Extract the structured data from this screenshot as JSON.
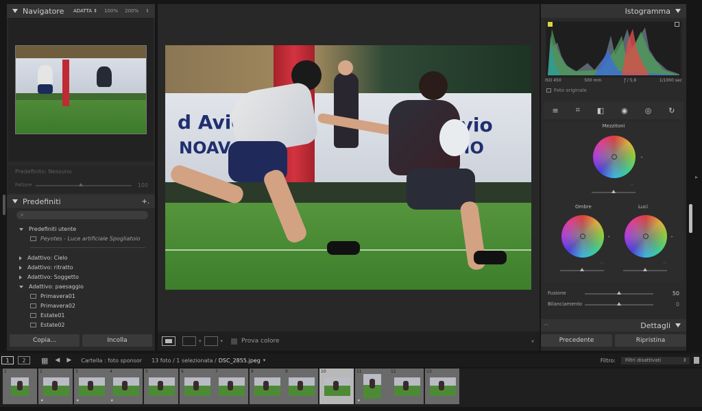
{
  "navigator": {
    "title": "Navigatore",
    "opts": [
      "ADATTA ⇕",
      "100%",
      "200%",
      "⇕"
    ]
  },
  "preset_strength": {
    "label": "Predefinito: Nessuno",
    "slider_label": "Fattore",
    "value": "100"
  },
  "presets": {
    "title": "Predefiniti",
    "plus": "+.",
    "search_placeholder": "",
    "user_group": "Predefiniti utente",
    "user_item": "Peyotes - Luce artificiale Spogliatoio",
    "groups": [
      "Adattivo: Cielo",
      "Adattivo: ritratto",
      "Adattivo: Soggetto",
      "Adattivo: paesaggio"
    ],
    "items": [
      "Primavera01",
      "Primavera02",
      "Estate01",
      "Estate02"
    ]
  },
  "left_buttons": {
    "copy": "Copia...",
    "paste": "Incolla"
  },
  "histogram": {
    "title": "Istogramma",
    "iso": "ISO 450",
    "focal": "500 mm",
    "aperture": "ƒ / 5,6",
    "shutter": "1/1000 sec",
    "original": "Foto originale"
  },
  "color_grading": {
    "midtones": "Mezzitoni",
    "shadows": "Ombre",
    "highlights": "Luci",
    "blending_label": "Fusione",
    "blending_value": "50",
    "balance_label": "Bilanciamento",
    "balance_value": "0"
  },
  "details": {
    "title": "Dettagli"
  },
  "right_buttons": {
    "previous": "Precedente",
    "reset": "Ripristina"
  },
  "toolbar": {
    "softproof": "Prova colore"
  },
  "filmstrip": {
    "page1": "1",
    "page2": "2",
    "folder": "Cartella : foto sponsor",
    "count": "13 foto / 1 selezionata /",
    "filename": "DSC_2855.jpeg",
    "filter_label": "Filtro:",
    "filter_value": "Filtri disattivati",
    "thumbs": [
      "1",
      "2",
      "3",
      "4",
      "5",
      "6",
      "7",
      "8",
      "9",
      "10",
      "11",
      "12",
      "13"
    ]
  },
  "colors": {
    "panel": "#2a2a2a",
    "background": "#161616",
    "text": "#b8b8b8"
  }
}
